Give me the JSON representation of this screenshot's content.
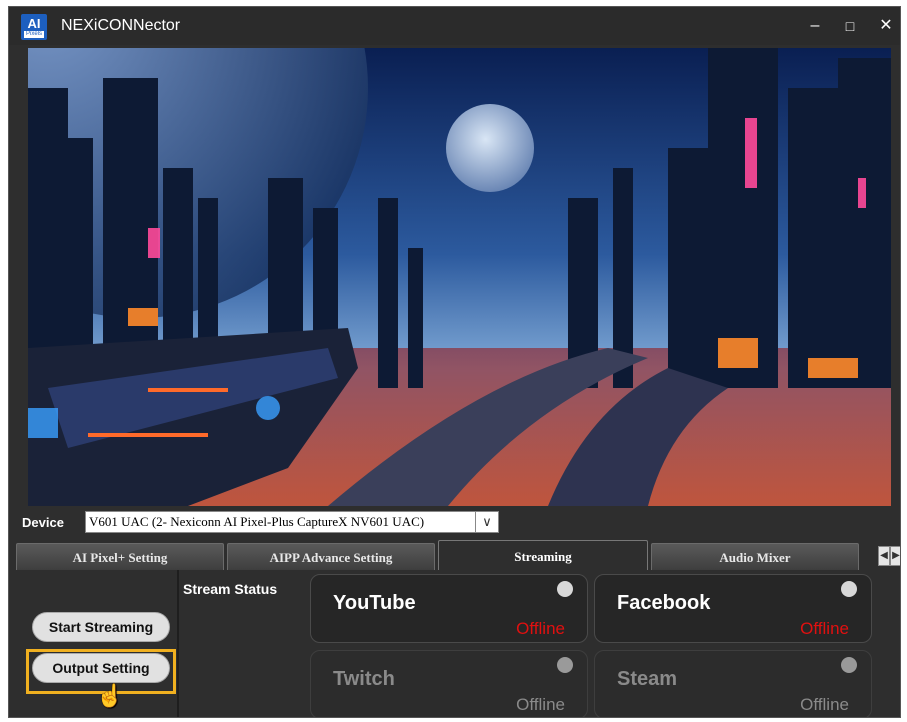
{
  "window": {
    "title": "NEXiCONNector",
    "app_icon": {
      "name": "ai-pixels-logo-icon",
      "text": "AI",
      "subtext": "Pixels"
    },
    "controls": {
      "minimize": "–",
      "maximize": "□",
      "close": "✕"
    }
  },
  "preview": {
    "description_icon": "cyberpunk-city-preview-image"
  },
  "device": {
    "label": "Device",
    "selected": "V601 UAC (2- Nexiconn AI Pixel-Plus CaptureX NV601 UAC)",
    "arrow": "∨"
  },
  "tabs": [
    {
      "label": "AI Pixel+ Setting",
      "active": false
    },
    {
      "label": "AIPP Advance Setting",
      "active": false
    },
    {
      "label": "Streaming",
      "active": true
    },
    {
      "label": "Audio Mixer",
      "active": false
    }
  ],
  "tab_nav": {
    "prev": "◀",
    "next": "▶"
  },
  "streaming": {
    "start_button": "Start Streaming",
    "output_button": "Output Setting",
    "status_label": "Stream Status",
    "platforms": [
      {
        "name": "YouTube",
        "status": "Offline",
        "enabled": true
      },
      {
        "name": "Facebook",
        "status": "Offline",
        "enabled": true
      },
      {
        "name": "Twitch",
        "status": "Offline",
        "enabled": false
      },
      {
        "name": "Steam",
        "status": "Offline",
        "enabled": false
      }
    ]
  },
  "colors": {
    "highlight": "#f0b020",
    "offline_red": "#e01010",
    "app_blue": "#1d5fbf"
  }
}
